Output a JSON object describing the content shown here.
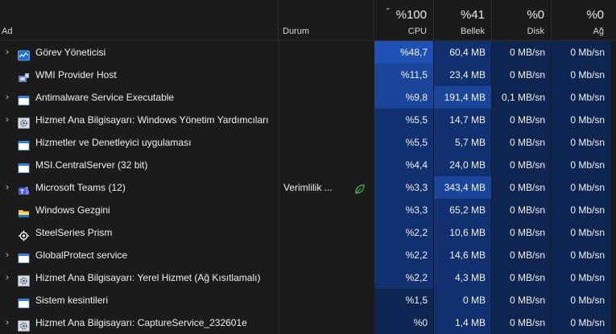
{
  "header": {
    "name_label": "Ad",
    "status_label": "Durum",
    "cpu": {
      "value": "%100",
      "label": "CPU"
    },
    "memory": {
      "value": "%41",
      "label": "Bellek"
    },
    "disk": {
      "value": "%0",
      "label": "Disk"
    },
    "network": {
      "value": "%0",
      "label": "Ağ"
    }
  },
  "colors": {
    "background": "#1b1b1b",
    "heat_dark": "#0d2550",
    "heat_mid": "#113070",
    "heat_high": "#1a4599",
    "heat_top": "#1f51b5",
    "eco_leaf": "#4caf50"
  },
  "rows": [
    {
      "name": "Görev Yöneticisi",
      "icon": "task-manager-icon",
      "expand": true,
      "status": "",
      "cpu": "%48,7",
      "memory": "60,4 MB",
      "disk": "0 MB/sn",
      "network": "0 Mb/sn"
    },
    {
      "name": "WMI Provider Host",
      "icon": "wmi-host-icon",
      "expand": false,
      "status": "",
      "cpu": "%11,5",
      "memory": "23,4 MB",
      "disk": "0 MB/sn",
      "network": "0 Mb/sn"
    },
    {
      "name": "Antimalware Service Executable",
      "icon": "window-app-icon",
      "expand": true,
      "status": "",
      "cpu": "%9,8",
      "memory": "191,4 MB",
      "disk": "0,1 MB/sn",
      "network": "0 Mb/sn"
    },
    {
      "name": "Hizmet Ana Bilgisayarı: Windows Yönetim Yardımcıları",
      "icon": "service-gear-icon",
      "expand": true,
      "status": "",
      "cpu": "%5,5",
      "memory": "14,7 MB",
      "disk": "0 MB/sn",
      "network": "0 Mb/sn"
    },
    {
      "name": "Hizmetler ve Denetleyici uygulaması",
      "icon": "window-app-icon",
      "expand": false,
      "status": "",
      "cpu": "%5,5",
      "memory": "5,7 MB",
      "disk": "0 MB/sn",
      "network": "0 Mb/sn"
    },
    {
      "name": "MSI.CentralServer (32 bit)",
      "icon": "window-app-icon",
      "expand": false,
      "status": "",
      "cpu": "%4,4",
      "memory": "24,0 MB",
      "disk": "0 MB/sn",
      "network": "0 Mb/sn"
    },
    {
      "name": "Microsoft Teams (12)",
      "icon": "teams-icon",
      "expand": true,
      "status": "Verimlilik ...",
      "eco": true,
      "cpu": "%3,3",
      "memory": "343,4 MB",
      "disk": "0 MB/sn",
      "network": "0 Mb/sn"
    },
    {
      "name": "Windows Gezgini",
      "icon": "folder-icon",
      "expand": false,
      "status": "",
      "cpu": "%3,3",
      "memory": "65,2 MB",
      "disk": "0 MB/sn",
      "network": "0 Mb/sn"
    },
    {
      "name": "SteelSeries Prism",
      "icon": "steelseries-icon",
      "expand": false,
      "status": "",
      "cpu": "%2,2",
      "memory": "10,6 MB",
      "disk": "0 MB/sn",
      "network": "0 Mb/sn"
    },
    {
      "name": "GlobalProtect service",
      "icon": "window-app-icon",
      "expand": true,
      "status": "",
      "cpu": "%2,2",
      "memory": "14,6 MB",
      "disk": "0 MB/sn",
      "network": "0 Mb/sn"
    },
    {
      "name": "Hizmet Ana Bilgisayarı: Yerel Hizmet (Ağ Kısıtlamalı)",
      "icon": "service-gear-icon",
      "expand": true,
      "status": "",
      "cpu": "%2,2",
      "memory": "4,3 MB",
      "disk": "0 MB/sn",
      "network": "0 Mb/sn"
    },
    {
      "name": "Sistem kesintileri",
      "icon": "window-app-icon",
      "expand": false,
      "status": "",
      "cpu": "%1,5",
      "memory": "0 MB",
      "disk": "0 MB/sn",
      "network": "0 Mb/sn"
    },
    {
      "name": "Hizmet Ana Bilgisayarı: CaptureService_232601e",
      "icon": "service-gear-icon",
      "expand": true,
      "status": "",
      "cpu": "%0",
      "memory": "1,4 MB",
      "disk": "0 MB/sn",
      "network": "0 Mb/sn"
    }
  ]
}
